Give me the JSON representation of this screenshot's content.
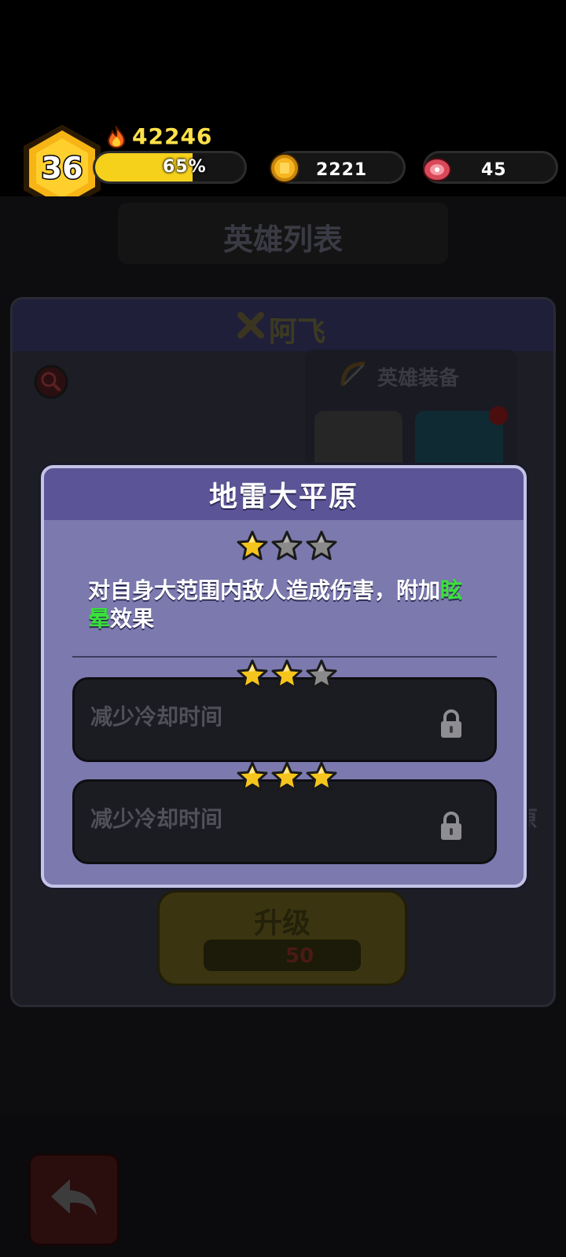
{
  "hud": {
    "level": "36",
    "power": "42246",
    "xp_percent_text": "65%",
    "xp_progress": 0.65,
    "coins": "2221",
    "meat": "45"
  },
  "background": {
    "screen_title": "英雄列表",
    "hero_name": "阿飞",
    "equipment_title": "英雄装备",
    "upgrade_label": "升级",
    "upgrade_cost": "50",
    "side_text": "原"
  },
  "modal": {
    "title": "地雷大平原",
    "current_stars": 1,
    "description_before": "对自身大范围内敌人造成伤害，附加",
    "description_highlight": "眩晕",
    "description_after": "效果",
    "upgrades": [
      {
        "stars": 2,
        "label": "减少冷却时间",
        "locked": true
      },
      {
        "stars": 3,
        "label": "减少冷却时间",
        "locked": true
      }
    ]
  },
  "colors": {
    "gold": "#f6c51d",
    "highlight_green": "#3be03b",
    "modal_bg": "#7b79ae",
    "modal_header": "#5b5496"
  }
}
